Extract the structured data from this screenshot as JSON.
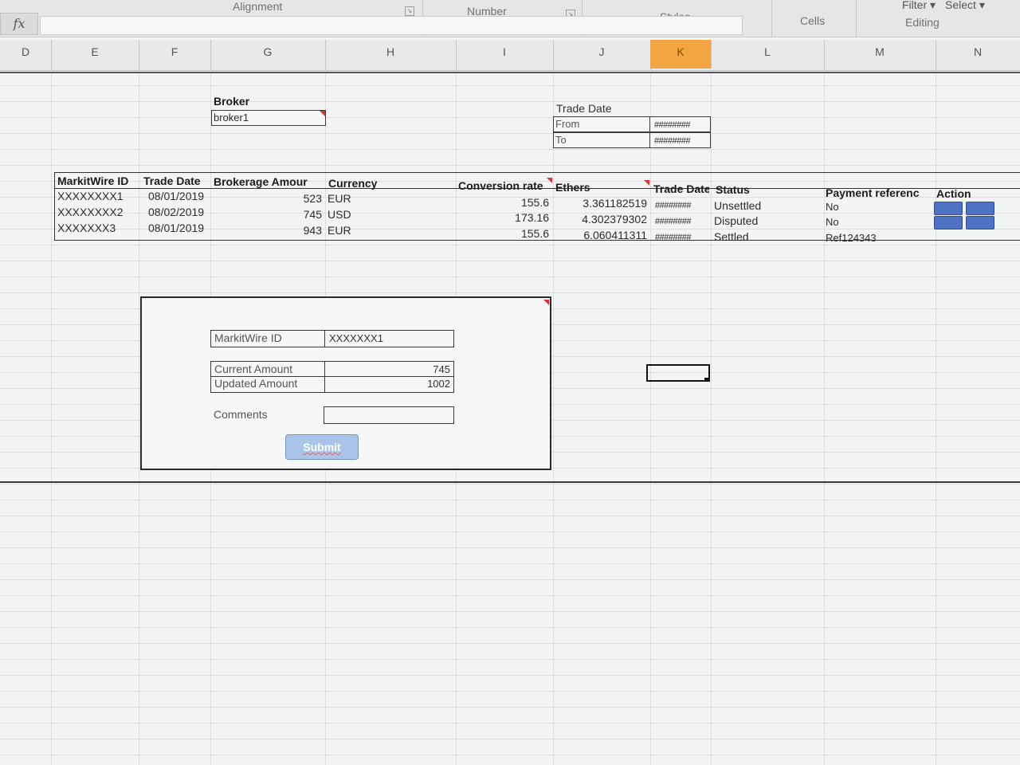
{
  "ribbon": {
    "groups": {
      "alignment": "Alignment",
      "number": "Number",
      "styles": "Styles",
      "cells": "Cells",
      "editing": "Editing"
    },
    "filter_label": "Filter",
    "select_label": "Select"
  },
  "formula_bar": {
    "fx_label": "fx",
    "value": ""
  },
  "column_headers": [
    "D",
    "E",
    "F",
    "G",
    "H",
    "I",
    "J",
    "K",
    "L",
    "M",
    "N"
  ],
  "selected_column": "K",
  "broker": {
    "label": "Broker",
    "value": "broker1"
  },
  "trade_date_filter": {
    "label": "Trade Date",
    "from_label": "From",
    "to_label": "To",
    "from_value": "########",
    "to_value": "########"
  },
  "table": {
    "headers": {
      "markitwire_id": "MarkitWire ID",
      "trade_date": "Trade Date",
      "brokerage_amount": "Brokerage Amour",
      "currency": "Currency",
      "conversion_rate": "Conversion rate",
      "ethers": "Ethers",
      "trade_date2": "Trade Date",
      "status": "Status",
      "payment_reference": "Payment referenc",
      "action": "Action"
    },
    "rows": [
      {
        "id": "XXXXXXXX1",
        "trade_date": "08/01/2019",
        "amount": "523",
        "currency": "EUR",
        "conversion_rate": "155.6",
        "ethers": "3.361182519",
        "trade_date2": "########",
        "status": "Unsettled",
        "payment_reference": "No"
      },
      {
        "id": "XXXXXXXX2",
        "trade_date": "08/02/2019",
        "amount": "745",
        "currency": "USD",
        "conversion_rate": "173.16",
        "ethers": "4.302379302",
        "trade_date2": "########",
        "status": "Disputed",
        "payment_reference": "No"
      },
      {
        "id": "XXXXXXX3",
        "trade_date": "08/01/2019",
        "amount": "943",
        "currency": "EUR",
        "conversion_rate": "155.6",
        "ethers": "6.060411311",
        "trade_date2": "########",
        "status": "Settled",
        "payment_reference": "Ref124343"
      }
    ]
  },
  "form": {
    "markitwire_label": "MarkitWire ID",
    "markitwire_value": "XXXXXXX1",
    "current_amount_label": "Current Amount",
    "current_amount_value": "745",
    "updated_amount_label": "Updated Amount",
    "updated_amount_value": "1002",
    "comments_label": "Comments",
    "comments_value": "",
    "submit_label": "Submit"
  },
  "colors": {
    "selected_column": "#f2a541",
    "action_button": "#4f72c4",
    "submit_button": "#a9c6ea"
  }
}
